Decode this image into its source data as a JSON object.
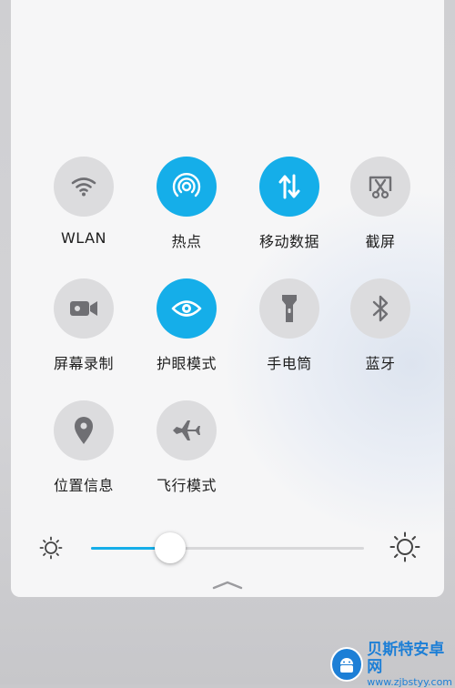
{
  "quick_settings": {
    "tiles": [
      {
        "label": "WLAN",
        "icon": "wifi-icon",
        "active": false
      },
      {
        "label": "热点",
        "icon": "hotspot-icon",
        "active": true
      },
      {
        "label": "移动数据",
        "icon": "mobile-data-icon",
        "active": true
      },
      {
        "label": "截屏",
        "icon": "screenshot-icon",
        "active": false
      },
      {
        "label": "屏幕录制",
        "icon": "screen-record-icon",
        "active": false
      },
      {
        "label": "护眼模式",
        "icon": "eye-icon",
        "active": true
      },
      {
        "label": "手电筒",
        "icon": "flashlight-icon",
        "active": false
      },
      {
        "label": "蓝牙",
        "icon": "bluetooth-icon",
        "active": false
      },
      {
        "label": "位置信息",
        "icon": "location-icon",
        "active": false
      },
      {
        "label": "飞行模式",
        "icon": "airplane-icon",
        "active": false
      }
    ]
  },
  "brightness": {
    "level_fraction": 0.29,
    "min_icon": "sun-dim-icon",
    "max_icon": "sun-bright-icon"
  },
  "watermark": {
    "name": "贝斯特安卓网",
    "url": "www.zjbstyy.com"
  },
  "colors": {
    "accent": "#15aee9",
    "tile_inactive": "#dcdcde",
    "icon_inactive": "#6f6f73"
  }
}
